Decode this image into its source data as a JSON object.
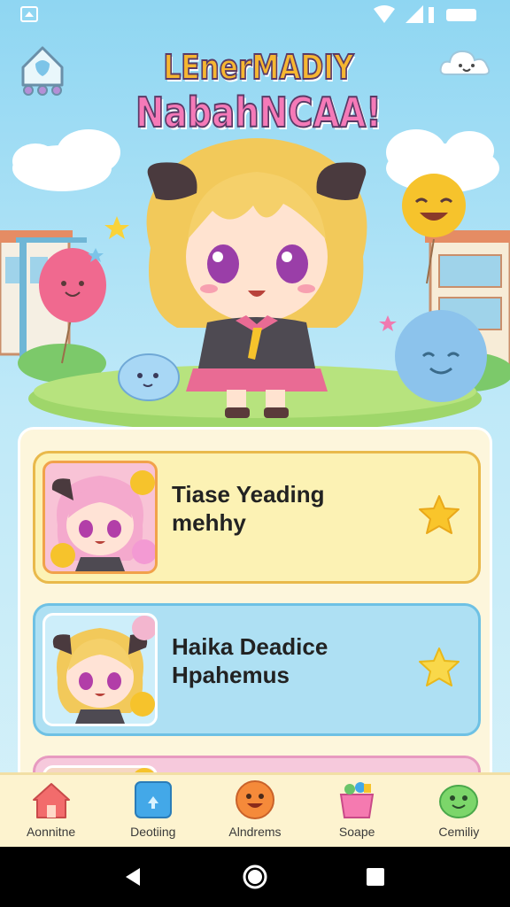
{
  "app": {
    "title_line1": "LEnerMADIY",
    "title_line2": "NabahNCAA!"
  },
  "cards": [
    {
      "title": "Tiase Yeading mehhy"
    },
    {
      "title": "Haika Deadice Hpahemus"
    },
    {
      "title": ""
    }
  ],
  "nav": {
    "items": [
      {
        "label": "Aonnitne",
        "icon": "house-icon"
      },
      {
        "label": "Deotiing",
        "icon": "blue-box-icon"
      },
      {
        "label": "Alndrems",
        "icon": "orange-face-icon"
      },
      {
        "label": "Soape",
        "icon": "toy-bucket-icon"
      },
      {
        "label": "Cemiliy",
        "icon": "green-blob-icon"
      }
    ]
  },
  "colors": {
    "sky": "#8fd6f2",
    "panel": "#fdf6dc",
    "card1": "#fcf2b4",
    "card2": "#aee0f3",
    "card3": "#f6c9dc",
    "nav_bg": "#fdf3cf",
    "star": "#f9c52b"
  }
}
